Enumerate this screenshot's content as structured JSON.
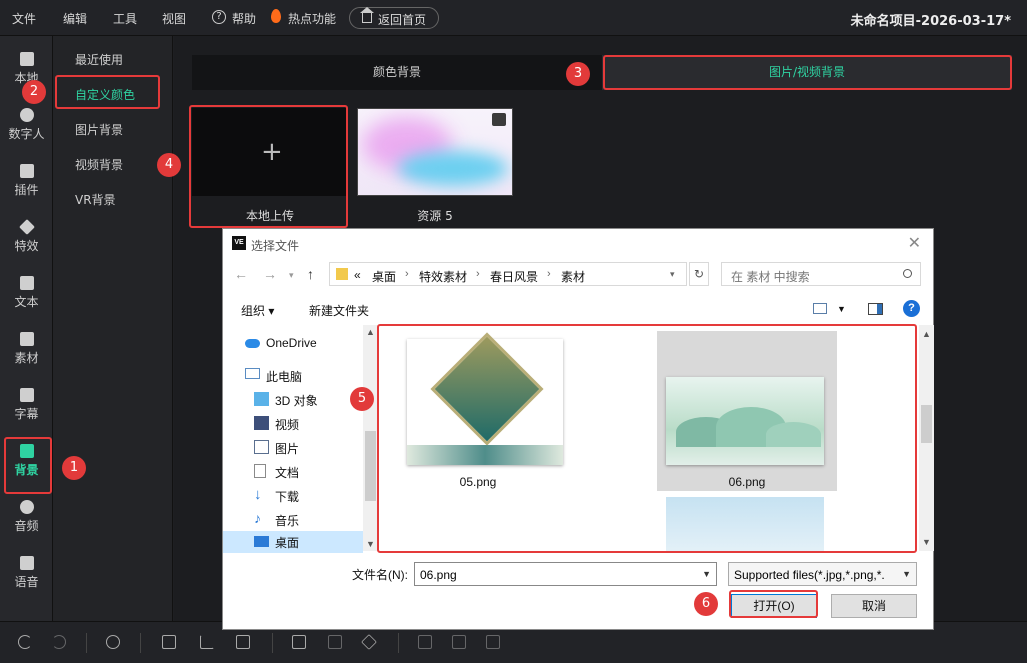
{
  "menubar": {
    "items": [
      "文件",
      "编辑",
      "工具",
      "视图"
    ],
    "help": "帮助",
    "hot": "热点功能",
    "home": "返回首页",
    "project_title": "未命名项目-2026-03-17*"
  },
  "sidebar": {
    "items": [
      {
        "label": "本地"
      },
      {
        "label": "数字人"
      },
      {
        "label": "插件"
      },
      {
        "label": "特效"
      },
      {
        "label": "文本"
      },
      {
        "label": "素材"
      },
      {
        "label": "字幕"
      },
      {
        "label": "背景",
        "active": true
      },
      {
        "label": "音频"
      },
      {
        "label": "语音"
      }
    ]
  },
  "categories": [
    "最近使用",
    "自定义颜色",
    "图片背景",
    "视频背景",
    "VR背景"
  ],
  "tabs": [
    "颜色背景",
    "图片/视频背景"
  ],
  "tiles": {
    "upload": "本地上传",
    "resource": "资源 5"
  },
  "markers": [
    "1",
    "2",
    "3",
    "4",
    "5",
    "6"
  ],
  "dialog": {
    "title": "选择文件",
    "app_badge": "VE",
    "breadcrumb": [
      "«",
      "桌面",
      "特效素材",
      "春日风景",
      "素材"
    ],
    "search_placeholder": "在 素材 中搜索",
    "organize": "组织 ▾",
    "new_folder": "新建文件夹",
    "help_icon": "?",
    "nav": [
      "OneDrive",
      "此电脑",
      "3D 对象",
      "视频",
      "图片",
      "文档",
      "下载",
      "音乐",
      "桌面"
    ],
    "files": [
      "05.png",
      "06.png"
    ],
    "filename_label": "文件名(N):",
    "filename_value": "06.png",
    "filetype_value": "Supported files(*.jpg,*.png,*.",
    "open_button": "打开(O)",
    "cancel_button": "取消"
  },
  "colors": {
    "accent": "#2fd3a2",
    "highlight": "#e53a3a"
  }
}
